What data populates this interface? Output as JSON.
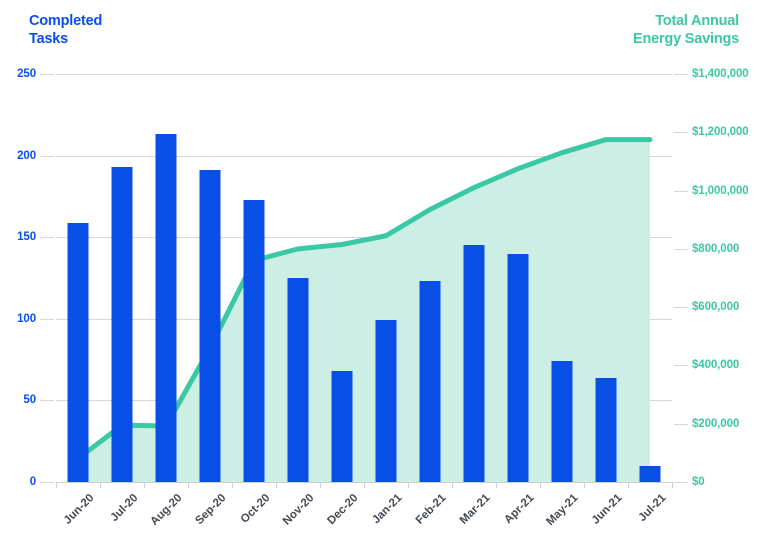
{
  "axes": {
    "left_title": "Completed\nTasks",
    "left_title_line1": "Completed",
    "left_title_line2": "Tasks",
    "right_title_line1": "Total Annual",
    "right_title_line2": "Energy Savings",
    "left_ticks": [
      "250",
      "200",
      "150",
      "100",
      "50",
      "0"
    ],
    "right_ticks": [
      "$1,400,000",
      "$1,200,000",
      "$1,000,000",
      "$800,000",
      "$600,000",
      "$400,000",
      "$200,000",
      "$0"
    ]
  },
  "colors": {
    "bar_blue": "#0a4ee8",
    "left_axis_text": "#0a4ef0",
    "line_teal": "#3ac9a4",
    "area_fill": "#cdeee4",
    "grid": "#d8d8d8",
    "x_label": "#454a52",
    "background": "#ffffff"
  },
  "chart_data": {
    "type": "bar",
    "title": "",
    "subtitle": "",
    "xlabel": "",
    "ylabel": "Completed Tasks",
    "y2label": "Total Annual Energy Savings",
    "grid": true,
    "legend": "none",
    "categories": [
      "Jun-20",
      "Jul-20",
      "Aug-20",
      "Sep-20",
      "Oct-20",
      "Nov-20",
      "Dec-20",
      "Jan-21",
      "Feb-21",
      "Mar-21",
      "Apr-21",
      "May-21",
      "Jun-21",
      "Jul-21"
    ],
    "ylim": [
      0,
      250
    ],
    "ytick_values": [
      250,
      200,
      150,
      100,
      50,
      0
    ],
    "y2lim": [
      0,
      1400000
    ],
    "y2tick_values": [
      1400000,
      1200000,
      1000000,
      800000,
      600000,
      400000,
      200000,
      0
    ],
    "series": [
      {
        "name": "Completed Tasks",
        "type": "bar",
        "axis": "left",
        "color": "#0a4ee8",
        "values": [
          159,
          193,
          213,
          191,
          173,
          125,
          68,
          99,
          123,
          145,
          140,
          74,
          64,
          10
        ]
      },
      {
        "name": "Total Annual Energy Savings",
        "type": "area",
        "axis": "right",
        "color": "#3ac9a4",
        "fill": "#cdeee4",
        "values": [
          80000,
          195000,
          192000,
          460000,
          760000,
          800000,
          815000,
          845000,
          935000,
          1010000,
          1075000,
          1130000,
          1175000,
          1175000
        ]
      }
    ]
  }
}
